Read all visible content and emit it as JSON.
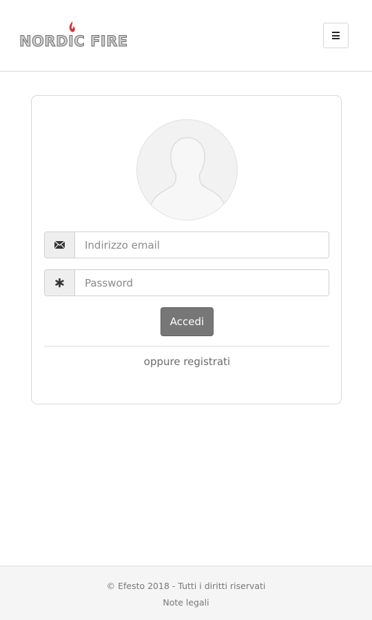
{
  "header": {
    "logo_text": "NORDIC FIRE",
    "logo_accent_color": "#d4343a",
    "menu_icon": "hamburger-icon"
  },
  "login": {
    "avatar_icon": "user-silhouette-icon",
    "email": {
      "icon": "envelope-icon",
      "placeholder": "Indirizzo email",
      "value": ""
    },
    "password": {
      "icon": "asterisk-icon",
      "placeholder": "Password",
      "value": ""
    },
    "submit_label": "Accedi",
    "register_label": "oppure registrati"
  },
  "footer": {
    "copyright": "© Efesto 2018 - Tutti i diritti riservati",
    "legal_link": "Note legali"
  }
}
